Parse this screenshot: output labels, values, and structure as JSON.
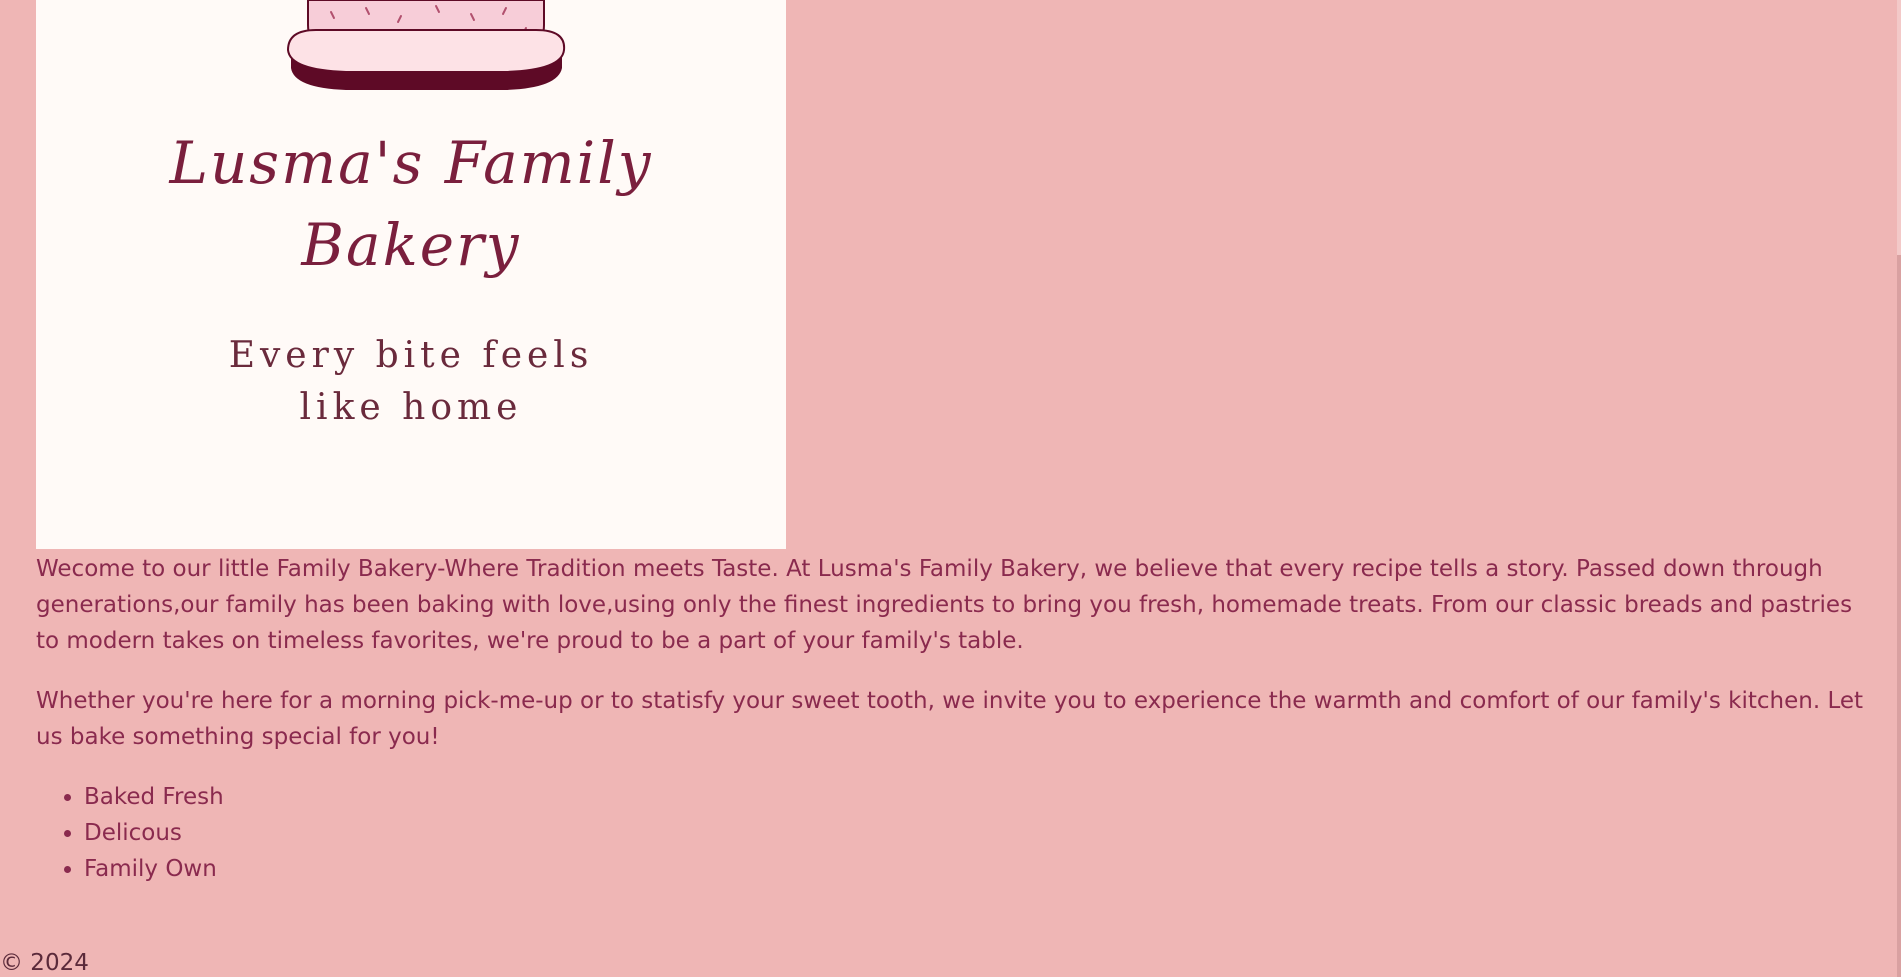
{
  "logo": {
    "brand_name_line1": "Lusma's Family",
    "brand_name_line2": "Bakery",
    "tagline_line1": "Every bite feels",
    "tagline_line2": "like home",
    "icon": "cake-icon"
  },
  "main": {
    "paragraph1": "Wecome to our little Family Bakery-Where Tradition meets Taste. At Lusma's Family Bakery, we believe that every recipe tells a story. Passed down through generations,our family has been baking with love,using only the finest ingredients to bring you fresh, homemade treats. From our classic breads and pastries to modern takes on timeless favorites, we're proud to be a part of your family's table.",
    "paragraph2": "Whether you're here for a morning pick-me-up or to statisfy your sweet tooth, we invite you to experience the warmth and comfort of our family's kitchen. Let us bake something special for you!",
    "features": [
      "Baked Fresh",
      "Delicous",
      "Family Own"
    ]
  },
  "footer": {
    "copyright": "© 2024"
  },
  "colors": {
    "background": "#efb6b5",
    "text": "#8a2a4e",
    "logo_background": "#fffaf7",
    "cake_pink": "#f7cdd8",
    "cake_plate_dark": "#5e0a26"
  }
}
